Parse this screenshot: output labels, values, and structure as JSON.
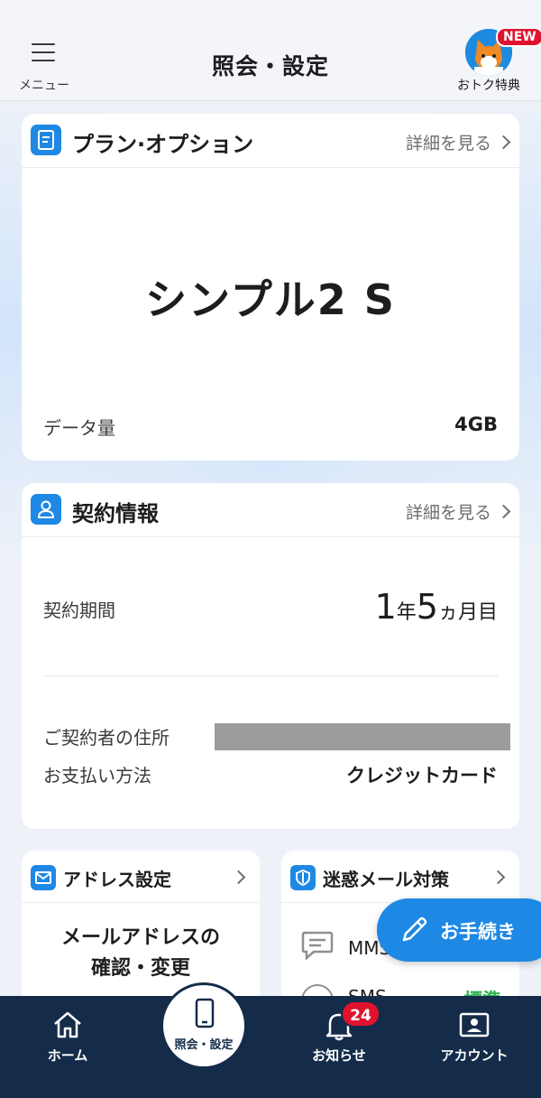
{
  "header": {
    "menu_label": "メニュー",
    "title": "照会・設定",
    "deal_label": "おトク特典",
    "new_badge": "NEW"
  },
  "plan_card": {
    "title": "プラン·オプション",
    "detail_link": "詳細を見る",
    "plan_name": "シンプル2 S",
    "data_label": "データ量",
    "data_value": "4GB"
  },
  "contract_card": {
    "title": "契約情報",
    "detail_link": "詳細を見る",
    "period_label": "契約期間",
    "period_years": "1",
    "period_year_unit": "年",
    "period_months": "5",
    "period_month_unit": "ヵ月目",
    "address_label": "ご契約者の住所",
    "payment_label": "お支払い方法",
    "payment_value": "クレジットカード"
  },
  "address_card": {
    "title": "アドレス設定",
    "line1": "メールアドレスの",
    "line2": "確認・変更"
  },
  "spam_card": {
    "title": "迷惑メール対策",
    "row1_label": "MMS",
    "row2_label": "SMS",
    "row2_value": "標準"
  },
  "fab": {
    "label": "お手続き"
  },
  "nav": {
    "home": "ホーム",
    "inquiry": "照会・設定",
    "notices": "お知らせ",
    "notices_count": "24",
    "account": "アカウント"
  },
  "colors": {
    "accent": "#1e88e5",
    "nav_bg": "#142c4a",
    "badge_red": "#e0132f",
    "green": "#2bb24c"
  }
}
